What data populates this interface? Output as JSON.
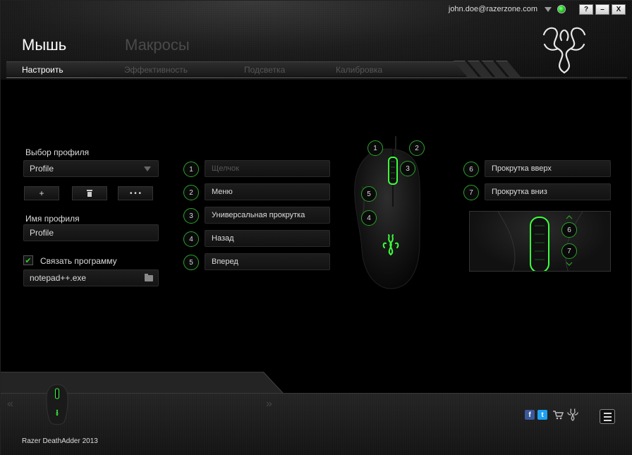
{
  "topbar": {
    "user_email": "john.doe@razerzone.com",
    "help": "?",
    "minimize": "–",
    "close": "X"
  },
  "main_tabs": [
    {
      "label": "Мышь",
      "active": true
    },
    {
      "label": "Макросы",
      "active": false
    }
  ],
  "sub_tabs": [
    {
      "label": "Настроить",
      "active": true
    },
    {
      "label": "Эффективность",
      "active": false
    },
    {
      "label": "Подсветка",
      "active": false
    },
    {
      "label": "Калибровка",
      "active": false
    }
  ],
  "profile": {
    "select_label": "Выбор профиля",
    "selected": "Profile",
    "add_label": "+",
    "delete_icon": "trash-icon",
    "more_label": "• • •",
    "name_label": "Имя профиля",
    "name_value": "Profile",
    "link_label": "Связать программу",
    "link_checked": true,
    "program": "notepad++.exe"
  },
  "buttons": [
    {
      "num": "1",
      "label": "Щелчок",
      "dim": true
    },
    {
      "num": "2",
      "label": "Меню",
      "dim": false
    },
    {
      "num": "3",
      "label": "Универсальная прокрутка",
      "dim": false
    },
    {
      "num": "4",
      "label": "Назад",
      "dim": false
    },
    {
      "num": "5",
      "label": "Вперед",
      "dim": false
    },
    {
      "num": "6",
      "label": "Прокрутка вверх",
      "dim": false
    },
    {
      "num": "7",
      "label": "Прокрутка вниз",
      "dim": false
    }
  ],
  "mouse_markers": [
    "1",
    "2",
    "3",
    "5",
    "4"
  ],
  "scroll_markers": [
    "6",
    "7"
  ],
  "footer": {
    "device_name": "Razer DeathAdder 2013",
    "prev_arrow": "«",
    "next_arrow": "»",
    "icons": [
      "facebook-icon",
      "twitter-icon",
      "cart-icon",
      "razer-logo-icon",
      "menu-icon"
    ]
  },
  "colors": {
    "accent_green": "#2aa52a",
    "facebook": "#3b5998",
    "twitter": "#1da1f2"
  }
}
